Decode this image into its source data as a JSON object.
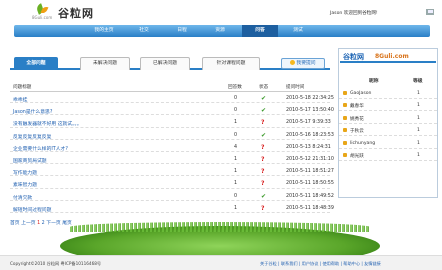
{
  "header": {
    "logo_sub": "8Guli.com",
    "logo_cn": "谷粒网",
    "user": "Jason",
    "welcome": "欢迎回到谷粒网!"
  },
  "nav": [
    "我的主页",
    "社交",
    "日程",
    "资源",
    "问答",
    "测试"
  ],
  "tabs": [
    "全部问题",
    "未解决问题",
    "已解决问题",
    "针对课程问题"
  ],
  "ask_button": "我要提问",
  "table": {
    "headers": [
      "问题标题",
      "回答数",
      "状态",
      "提问时间"
    ],
    "rows": [
      {
        "title": "乖乖挂",
        "count": "0",
        "status": "solved",
        "time": "2010-5-18 22:34:25"
      },
      {
        "title": "Jason是什么意思?",
        "count": "0",
        "status": "solved",
        "time": "2010-5-17 13:50:40"
      },
      {
        "title": "没有触发器就不好用 这就试。。。",
        "count": "1",
        "status": "open",
        "time": "2010-5-17 9:39:33"
      },
      {
        "title": "反复反复反复反复",
        "count": "0",
        "status": "solved",
        "time": "2010-5-16 18:23:53"
      },
      {
        "title": "企业需要什么样的IT人才?",
        "count": "4",
        "status": "open",
        "time": "2010-5-13 8:24:31"
      },
      {
        "title": "国家商贸局试题",
        "count": "1",
        "status": "open",
        "time": "2010-5-12 21:31:10"
      },
      {
        "title": "写作能力题",
        "count": "1",
        "status": "open",
        "time": "2010-5-11 18:51:27"
      },
      {
        "title": "素味智力题",
        "count": "1",
        "status": "open",
        "time": "2010-5-11 18:50:55"
      },
      {
        "title": "付清欠款",
        "count": "0",
        "status": "solved",
        "time": "2010-5-11 18:49:52"
      },
      {
        "title": "解短时间过程问题",
        "count": "1",
        "status": "open",
        "time": "2010-5-11 18:48:39"
      }
    ],
    "status_icons": {
      "solved": "✔",
      "open": "?"
    }
  },
  "pager": {
    "first": "首页",
    "prev": "上一页",
    "p1": "1",
    "p2": "2",
    "next": "下一页",
    "last": "尾页"
  },
  "sidebar": {
    "banner_cn": "谷粒网",
    "banner_en": "8Guli.com",
    "col_name": "昵称",
    "col_level": "等级",
    "users": [
      {
        "name": "GaoJason",
        "level": "1"
      },
      {
        "name": "戴春华",
        "level": "1"
      },
      {
        "name": "姚秀花",
        "level": "1"
      },
      {
        "name": "于秋云",
        "level": "1"
      },
      {
        "name": "lichunyang",
        "level": "1"
      },
      {
        "name": "胡光跃",
        "level": "1"
      }
    ]
  },
  "footer": {
    "copyright": "Copyright©2010 谷粒网 粤ICP备10116468号",
    "links": "关于谷粒 | 联系我们 | 用户协议 | 使用帮助 | 帮助中心 | 友情链接"
  }
}
